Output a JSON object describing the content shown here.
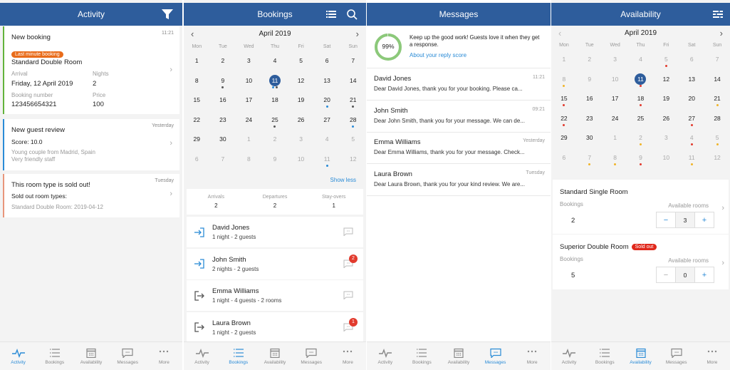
{
  "colors": {
    "header": "#2e5d9c",
    "accent": "#2a8bd6",
    "green": "#63b33b",
    "blue": "#2a8bd6",
    "orange": "#e96c1a",
    "red": "#e23b2e",
    "yellow": "#f0b429",
    "grey_dot": "#555555"
  },
  "tabs": [
    "Activity",
    "Bookings",
    "Availability",
    "Messages",
    "More"
  ],
  "activity": {
    "title": "Activity",
    "filter_icon": "filter-icon",
    "cards": [
      {
        "title": "New booking",
        "time": "11:21",
        "badge": "Last minute booking",
        "room": "Standard Double Room",
        "arrival_label": "Arrival",
        "arrival": "Friday, 12 April 2019",
        "nights_label": "Nights",
        "nights": "2",
        "booking_label": "Booking number",
        "booking_number": "123456654321",
        "price_label": "Price",
        "price": "100"
      },
      {
        "title": "New guest review",
        "time": "Yesterday",
        "score": "Score: 10.0",
        "line1": "Young couple from Madrid, Spain",
        "line2": "Very friendly staff"
      },
      {
        "title": "This room type is sold out!",
        "time": "Tuesday",
        "subtitle": "Sold out room types:",
        "detail": "Standard Double Room: 2019-04-12"
      }
    ]
  },
  "bookings": {
    "title": "Bookings",
    "month": "April 2019",
    "weekdays": [
      "Mon",
      "Tue",
      "Wed",
      "Thu",
      "Fri",
      "Sat",
      "Sun"
    ],
    "days": [
      {
        "n": "1"
      },
      {
        "n": "2"
      },
      {
        "n": "3"
      },
      {
        "n": "4"
      },
      {
        "n": "5"
      },
      {
        "n": "6"
      },
      {
        "n": "7"
      },
      {
        "n": "8"
      },
      {
        "n": "9",
        "dots": [
          "grey"
        ]
      },
      {
        "n": "10"
      },
      {
        "n": "11",
        "today": true,
        "dots": [
          "blue",
          "grey"
        ]
      },
      {
        "n": "12"
      },
      {
        "n": "13"
      },
      {
        "n": "14"
      },
      {
        "n": "15"
      },
      {
        "n": "16"
      },
      {
        "n": "17"
      },
      {
        "n": "18"
      },
      {
        "n": "19"
      },
      {
        "n": "20",
        "dots": [
          "blue"
        ]
      },
      {
        "n": "21",
        "dots": [
          "grey"
        ]
      },
      {
        "n": "22"
      },
      {
        "n": "23"
      },
      {
        "n": "24"
      },
      {
        "n": "25",
        "dots": [
          "grey"
        ]
      },
      {
        "n": "26"
      },
      {
        "n": "27"
      },
      {
        "n": "28",
        "dots": [
          "blue"
        ]
      },
      {
        "n": "29"
      },
      {
        "n": "30"
      },
      {
        "n": "1",
        "dim": true
      },
      {
        "n": "2",
        "dim": true
      },
      {
        "n": "3",
        "dim": true
      },
      {
        "n": "4",
        "dim": true
      },
      {
        "n": "5",
        "dim": true
      },
      {
        "n": "6",
        "dim": true
      },
      {
        "n": "7",
        "dim": true
      },
      {
        "n": "8",
        "dim": true
      },
      {
        "n": "9",
        "dim": true
      },
      {
        "n": "10",
        "dim": true
      },
      {
        "n": "11",
        "dim": true,
        "dots": [
          "blue"
        ]
      },
      {
        "n": "12",
        "dim": true
      }
    ],
    "show_less": "Show less",
    "stats": [
      {
        "label": "Arrivals",
        "value": "2"
      },
      {
        "label": "Departures",
        "value": "2"
      },
      {
        "label": "Stay-overs",
        "value": "1"
      }
    ],
    "list": [
      {
        "name": "David Jones",
        "detail": "1 night - 2 guests",
        "type": "arrival",
        "unread": ""
      },
      {
        "name": "John Smith",
        "detail": "2 nights - 2 guests",
        "type": "arrival",
        "unread": "2"
      },
      {
        "name": "Emma Williams",
        "detail": "1 night - 4 guests - 2 rooms",
        "type": "departure",
        "unread": ""
      },
      {
        "name": "Laura Brown",
        "detail": "1 night - 2 guests",
        "type": "departure",
        "unread": "1"
      }
    ]
  },
  "messages": {
    "title": "Messages",
    "score": "99%",
    "score_value": 0.99,
    "score_text": "Keep up the good work! Guests love it when they get a response.",
    "score_link": "About your reply score",
    "items": [
      {
        "name": "David Jones",
        "time": "11:21",
        "preview": "Dear David Jones, thank you for your booking. Please ca..."
      },
      {
        "name": "John Smith",
        "time": "09:21",
        "preview": "Dear John Smith, thank you for your message. We can de..."
      },
      {
        "name": "Emma Williams",
        "time": "Yesterday",
        "preview": "Dear Emma Williams, thank you for your message. Check..."
      },
      {
        "name": "Laura Brown",
        "time": "Tuesday",
        "preview": "Dear Laura Brown, thank you for your kind review. We are..."
      }
    ]
  },
  "availability": {
    "title": "Availability",
    "month": "April 2019",
    "weekdays": [
      "Mon",
      "Tue",
      "Wed",
      "Thu",
      "Fri",
      "Sat",
      "Sun"
    ],
    "days": [
      {
        "n": "1",
        "dim": true
      },
      {
        "n": "2",
        "dim": true
      },
      {
        "n": "3",
        "dim": true
      },
      {
        "n": "4",
        "dim": true
      },
      {
        "n": "5",
        "dim": true,
        "dots": [
          "red"
        ]
      },
      {
        "n": "6",
        "dim": true
      },
      {
        "n": "7",
        "dim": true
      },
      {
        "n": "8",
        "dim": true,
        "dots": [
          "yellow"
        ]
      },
      {
        "n": "9",
        "dim": true
      },
      {
        "n": "10",
        "dim": true
      },
      {
        "n": "11",
        "today": true,
        "dots": [
          "red"
        ]
      },
      {
        "n": "12"
      },
      {
        "n": "13"
      },
      {
        "n": "14"
      },
      {
        "n": "15",
        "dots": [
          "red"
        ]
      },
      {
        "n": "16"
      },
      {
        "n": "17"
      },
      {
        "n": "18",
        "dots": [
          "red"
        ]
      },
      {
        "n": "19"
      },
      {
        "n": "20"
      },
      {
        "n": "21",
        "dots": [
          "yellow"
        ]
      },
      {
        "n": "22",
        "dots": [
          "red"
        ]
      },
      {
        "n": "23"
      },
      {
        "n": "24"
      },
      {
        "n": "25"
      },
      {
        "n": "26"
      },
      {
        "n": "27",
        "dots": [
          "red"
        ]
      },
      {
        "n": "28"
      },
      {
        "n": "29"
      },
      {
        "n": "30"
      },
      {
        "n": "1",
        "dim": true
      },
      {
        "n": "2",
        "dim": true,
        "dots": [
          "yellow"
        ]
      },
      {
        "n": "3",
        "dim": true
      },
      {
        "n": "4",
        "dim": true,
        "dots": [
          "red"
        ]
      },
      {
        "n": "5",
        "dim": true,
        "dots": [
          "yellow"
        ]
      },
      {
        "n": "6",
        "dim": true
      },
      {
        "n": "7",
        "dim": true,
        "dots": [
          "yellow"
        ]
      },
      {
        "n": "8",
        "dim": true,
        "dots": [
          "yellow"
        ]
      },
      {
        "n": "9",
        "dim": true,
        "dots": [
          "red"
        ]
      },
      {
        "n": "10",
        "dim": true
      },
      {
        "n": "11",
        "dim": true,
        "dots": [
          "yellow"
        ]
      },
      {
        "n": "12",
        "dim": true
      }
    ],
    "rooms": [
      {
        "name": "Standard Single Room",
        "badge": "",
        "bookings_label": "Bookings",
        "bookings": "2",
        "available_label": "Available rooms",
        "available": "3",
        "minus": "−",
        "plus": "+"
      },
      {
        "name": "Superior Double Room",
        "badge": "Sold out",
        "bookings_label": "Bookings",
        "bookings": "5",
        "available_label": "Available rooms",
        "available": "0",
        "minus": "−",
        "plus": "+"
      }
    ]
  }
}
